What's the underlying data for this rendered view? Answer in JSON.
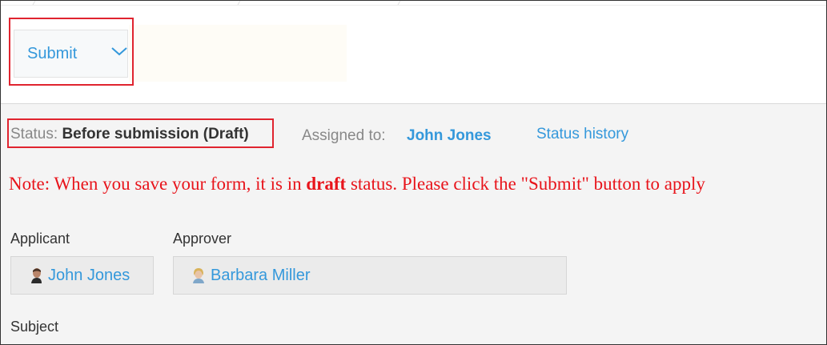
{
  "toolbar": {
    "submit_label": "Submit"
  },
  "status": {
    "label": "Status:",
    "value": "Before submission (Draft)",
    "assigned_label": "Assigned to:",
    "assigned_name": "John Jones",
    "history_link": "Status history"
  },
  "note": {
    "prefix": "Note: When you save your form, it is in ",
    "emphasis": "draft",
    "suffix": " status. Please click the \"Submit\" button to apply"
  },
  "form": {
    "applicant_label": "Applicant",
    "applicant_name": "John Jones",
    "approver_label": "Approver",
    "approver_name": "Barbara Miller",
    "subject_label": "Subject"
  },
  "colors": {
    "link": "#3498db",
    "highlight": "#e0242f",
    "note": "#e8141b"
  }
}
